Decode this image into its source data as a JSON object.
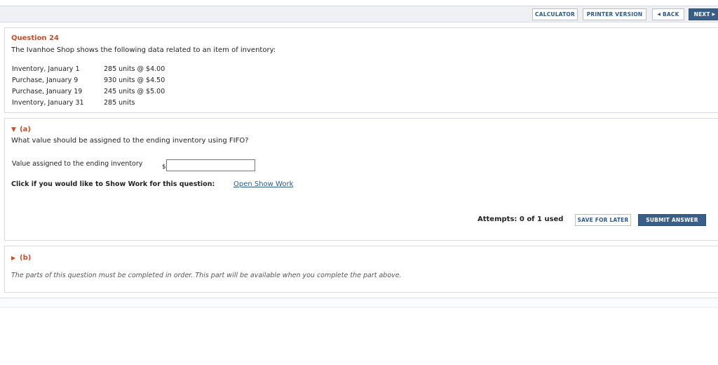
{
  "toolbar": {
    "calculator": "CALCULATOR",
    "printer_version": "PRINTER VERSION",
    "back": "BACK",
    "next": "NEXT"
  },
  "question": {
    "title": "Question 24",
    "text": "The Ivanhoe Shop shows the following data related to an item of inventory:",
    "inventory_rows": [
      {
        "label": "Inventory, January 1",
        "value": "285 units @ $4.00"
      },
      {
        "label": "Purchase, January 9",
        "value": "930 units @ $4.50"
      },
      {
        "label": "Purchase, January 19",
        "value": "245 units @ $5.00"
      },
      {
        "label": "Inventory, January 31",
        "value": "285 units"
      }
    ]
  },
  "part_a": {
    "header": "(a)",
    "prompt": "What value should be assigned to the ending inventory using FIFO?",
    "field_label": "Value assigned to the ending inventory",
    "currency": "$",
    "field_value": "",
    "show_work_text": "Click if you would like to Show Work for this question:",
    "show_work_link": "Open Show Work",
    "attempts": "Attempts: 0 of 1 used",
    "save_label": "SAVE FOR LATER",
    "submit_label": "SUBMIT ANSWER"
  },
  "part_b": {
    "header": "(b)",
    "notice": "The parts of this question must be completed in order. This part will be available when you complete the part above."
  },
  "colors": {
    "accent": "#c2502c",
    "link": "#2d5a85",
    "primary_button": "#3a5f86"
  }
}
